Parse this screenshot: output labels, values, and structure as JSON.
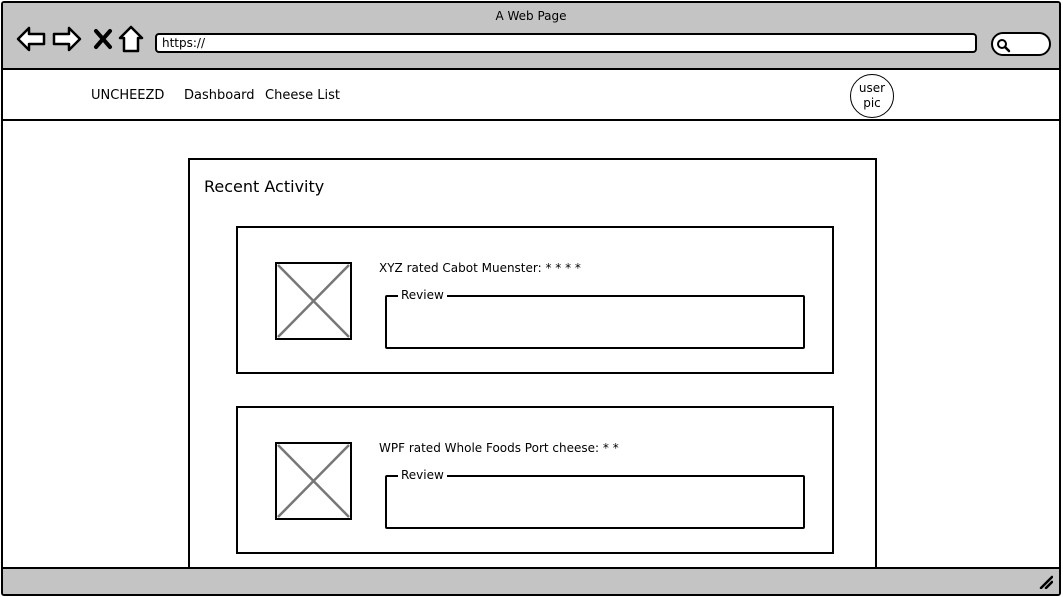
{
  "window": {
    "title": "A Web Page"
  },
  "browser": {
    "url": "https://",
    "icons": [
      "back-arrow-icon",
      "forward-arrow-icon",
      "close-x-icon",
      "home-icon",
      "search-icon"
    ]
  },
  "header": {
    "brand": "UNCHEEZD",
    "nav": [
      "Dashboard",
      "Cheese List"
    ],
    "avatar_lines": [
      "user",
      "pic"
    ]
  },
  "main": {
    "title": "Recent Activity",
    "activities": [
      {
        "text": "XYZ rated Cabot Muenster: * * * *",
        "review_label": "Review",
        "review_value": ""
      },
      {
        "text": "WPF rated Whole Foods Port cheese: * *",
        "review_label": "Review",
        "review_value": ""
      }
    ]
  }
}
